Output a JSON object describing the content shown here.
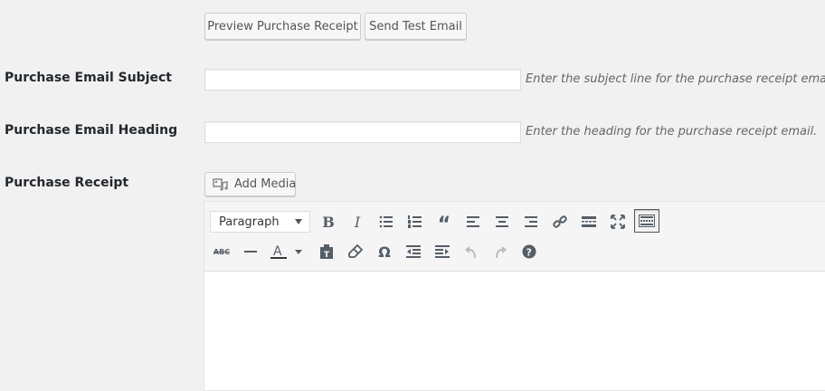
{
  "top_buttons": {
    "preview_label": "Preview Purchase Receipt",
    "test_email_label": "Send Test Email"
  },
  "fields": {
    "subject": {
      "label": "Purchase Email Subject",
      "value": "",
      "description": "Enter the subject line for the purchase receipt email."
    },
    "heading": {
      "label": "Purchase Email Heading",
      "value": "",
      "description": "Enter the heading for the purchase receipt email."
    },
    "receipt": {
      "label": "Purchase Receipt",
      "add_media_label": "Add Media"
    }
  },
  "editor": {
    "format_selected": "Paragraph",
    "toolbar_row1": [
      "bold-icon",
      "italic-icon",
      "bullet-list-icon",
      "numbered-list-icon",
      "blockquote-icon",
      "align-left-icon",
      "align-center-icon",
      "align-right-icon",
      "link-icon",
      "read-more-icon",
      "fullscreen-icon",
      "toolbar-toggle-icon"
    ],
    "toolbar_row2": [
      "strikethrough-icon",
      "horizontal-line-icon",
      "text-color-icon",
      "paste-text-icon",
      "clear-formatting-icon",
      "special-character-icon",
      "outdent-icon",
      "indent-icon",
      "undo-icon",
      "redo-icon",
      "help-icon"
    ],
    "content": ""
  }
}
